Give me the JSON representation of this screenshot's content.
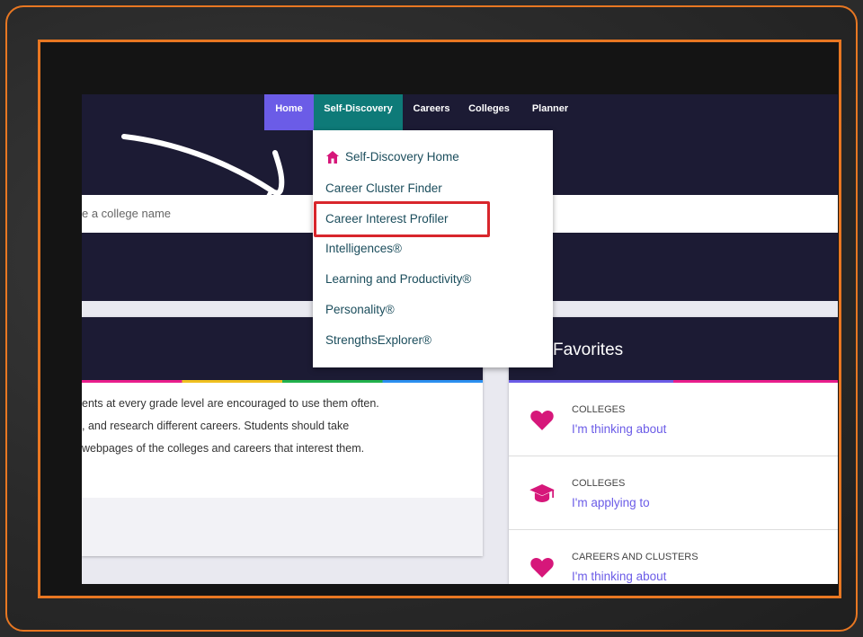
{
  "nav": {
    "items": [
      "Home",
      "Self-Discovery",
      "Careers",
      "Colleges",
      "Planner"
    ]
  },
  "search": {
    "placeholder": "e a college name"
  },
  "dropdown": {
    "items": [
      "Self-Discovery Home",
      "Career Cluster Finder",
      "Career Interest Profiler",
      "Intelligences®",
      "Learning and Productivity®",
      "Personality®",
      "StrengthsExplorer®"
    ],
    "highlighted_index": 2
  },
  "left_card": {
    "lines": [
      "ents at every grade level are encouraged to use them often.",
      ", and research different careers. Students should take",
      " webpages of the colleges and careers that interest them."
    ]
  },
  "favorites": {
    "title": "Favorites",
    "rows": [
      {
        "category": "COLLEGES",
        "link": "I'm thinking about",
        "icon": "heart-icon"
      },
      {
        "category": "COLLEGES",
        "link": "I'm applying to",
        "icon": "graduation-cap-icon"
      },
      {
        "category": "CAREERS AND CLUSTERS",
        "link": "I'm thinking about",
        "icon": "heart-icon"
      }
    ]
  },
  "colors": {
    "accent_orange": "#e87722",
    "nav_dark": "#1c1b34",
    "home_purple": "#6b5ce7",
    "self_discovery_teal": "#0e7a78",
    "icon_pink": "#d6177a",
    "highlight_red": "#d8262c"
  }
}
